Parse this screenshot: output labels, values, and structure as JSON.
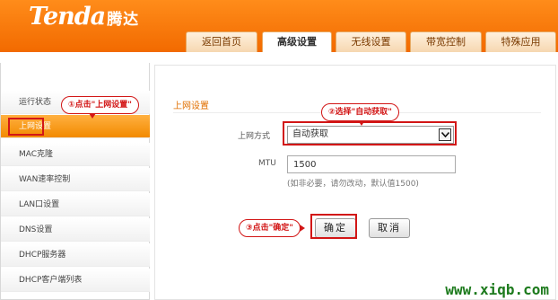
{
  "brand": {
    "logo": "Tenda",
    "logo_cn": "腾达"
  },
  "tabs": [
    {
      "label": "返回首页"
    },
    {
      "label": "高级设置"
    },
    {
      "label": "无线设置"
    },
    {
      "label": "带宽控制"
    },
    {
      "label": "特殊应用"
    }
  ],
  "sidebar": {
    "items": [
      {
        "label": "运行状态"
      },
      {
        "label": "上网设置"
      },
      {
        "label": "MAC克隆"
      },
      {
        "label": "WAN速率控制"
      },
      {
        "label": "LAN口设置"
      },
      {
        "label": "DNS设置"
      },
      {
        "label": "DHCP服务器"
      },
      {
        "label": "DHCP客户端列表"
      }
    ]
  },
  "main": {
    "section_title": "上网设置",
    "mode_label": "上网方式",
    "mode_value": "自动获取",
    "mtu_label": "MTU",
    "mtu_value": "1500",
    "mtu_hint": "(如非必要，请勿改动，默认值1500)",
    "ok_label": "确定",
    "cancel_label": "取消"
  },
  "annotations": {
    "step1": "①点击\"上网设置\"",
    "step2": "②选择\"自动获取\"",
    "step3": "③点击\"确定\""
  },
  "watermark": "www.xiqb.com",
  "colors": {
    "brand_orange": "#f57a00",
    "annotation_red": "#d21616"
  }
}
